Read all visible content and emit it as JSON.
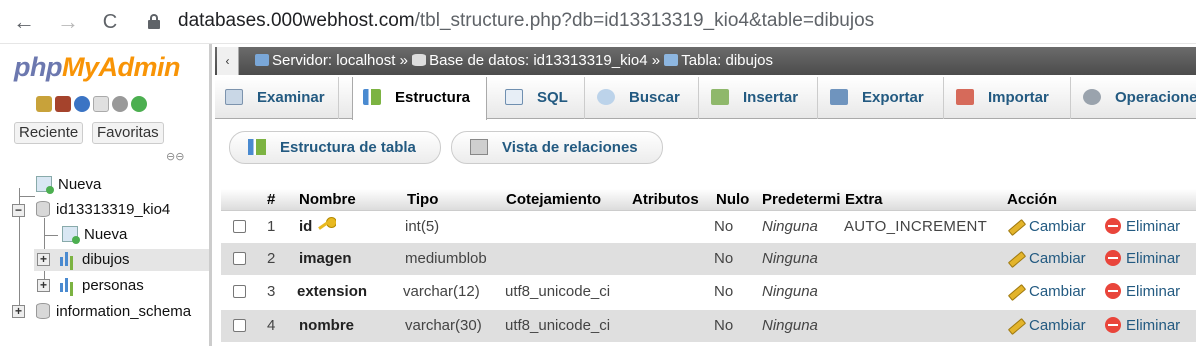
{
  "browser": {
    "back_glyph": "←",
    "forward_glyph": "→",
    "reload_glyph": "C",
    "url_domain": "databases.000webhost.com",
    "url_path": "/tbl_structure.php?db=id13313319_kio4&table=dibujos"
  },
  "logo": {
    "php": "php",
    "my": "MyAdmin",
    "admin": ""
  },
  "nav": {
    "recent_label": "Reciente",
    "favorites_label": "Favoritas",
    "tree": {
      "new_top": "Nueva",
      "db_name": "id13313319_kio4",
      "new_in_db": "Nueva",
      "table1": "dibujos",
      "table2": "personas",
      "db2": "information_schema"
    },
    "expander_minus": "−",
    "expander_plus": "+"
  },
  "breadcrumb": {
    "collapse_glyph": "‹",
    "server": "Servidor: localhost",
    "sep": "»",
    "database": "Base de datos: id13313319_kio4",
    "table": "Tabla: dibujos"
  },
  "tabs": [
    {
      "label": "Examinar"
    },
    {
      "label": "Estructura"
    },
    {
      "label": "SQL"
    },
    {
      "label": "Buscar"
    },
    {
      "label": "Insertar"
    },
    {
      "label": "Exportar"
    },
    {
      "label": "Importar"
    },
    {
      "label": "Operaciones"
    }
  ],
  "subnav": {
    "structure_label": "Estructura de tabla",
    "relations_label": "Vista de relaciones"
  },
  "table": {
    "headers": {
      "num": "#",
      "name": "Nombre",
      "type": "Tipo",
      "collation": "Cotejamiento",
      "attributes": "Atributos",
      "null": "Nulo",
      "default": "Predeterminado",
      "extra": "Extra",
      "action": "Acción"
    },
    "rows": [
      {
        "num": "1",
        "name": "id",
        "type": "int(5)",
        "collation": "",
        "attributes": "",
        "null": "No",
        "default": "Ninguna",
        "extra": "AUTO_INCREMENT",
        "change": "Cambiar",
        "drop": "Eliminar"
      },
      {
        "num": "2",
        "name": "imagen",
        "type": "mediumblob",
        "collation": "",
        "attributes": "",
        "null": "No",
        "default": "Ninguna",
        "extra": "",
        "change": "Cambiar",
        "drop": "Eliminar"
      },
      {
        "num": "3",
        "name": "extension",
        "type": "varchar(12)",
        "collation": "utf8_unicode_ci",
        "attributes": "",
        "null": "No",
        "default": "Ninguna",
        "extra": "",
        "change": "Cambiar",
        "drop": "Eliminar"
      },
      {
        "num": "4",
        "name": "nombre",
        "type": "varchar(30)",
        "collation": "utf8_unicode_ci",
        "attributes": "",
        "null": "No",
        "default": "Ninguna",
        "extra": "",
        "change": "Cambiar",
        "drop": "Eliminar"
      }
    ]
  },
  "colors": {
    "link": "#235a81",
    "breadcrumb_bg": "#5a5a5a",
    "row_alt": "#dfdfdf",
    "logo_blue": "#6c78af",
    "logo_orange": "#f89406"
  }
}
